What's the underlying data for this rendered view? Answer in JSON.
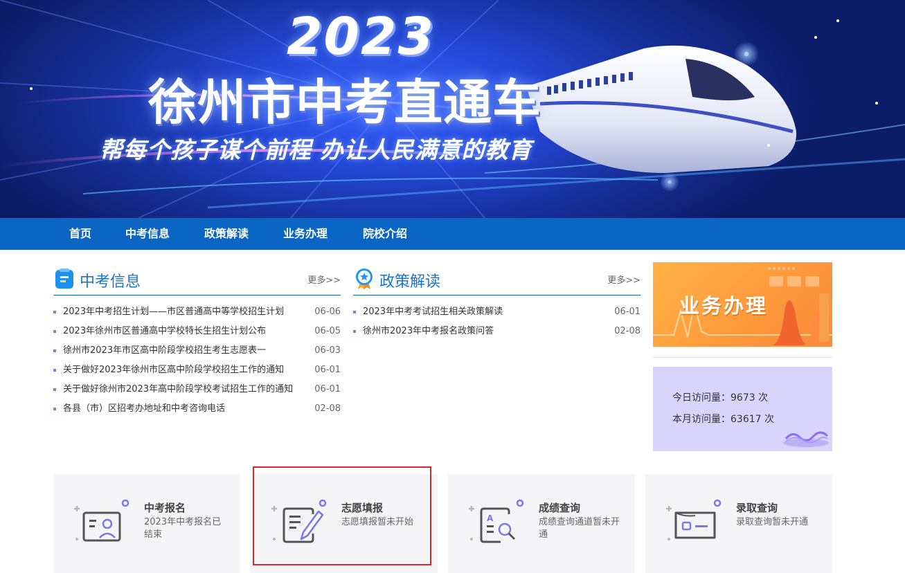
{
  "banner": {
    "year": "2023",
    "title": "徐州市中考直通车",
    "slogan": "帮每个孩子谋个前程  办让人民满意的教育"
  },
  "nav": {
    "items": [
      {
        "label": "首页"
      },
      {
        "label": "中考信息"
      },
      {
        "label": "政策解读"
      },
      {
        "label": "业务办理"
      },
      {
        "label": "院校介绍"
      }
    ]
  },
  "exam_info": {
    "title": "中考信息",
    "more": "更多>>",
    "items": [
      {
        "title": "2023年中考招生计划——市区普通高中等学校招生计划",
        "date": "06-06"
      },
      {
        "title": "2023年徐州市区普通高中学校特长生招生计划公布",
        "date": "06-05"
      },
      {
        "title": "徐州市2023年市区高中阶段学校招生考生志愿表一",
        "date": "06-03"
      },
      {
        "title": "关于做好2023年徐州市区高中阶段学校招生工作的通知",
        "date": "06-01"
      },
      {
        "title": "关于做好徐州市2023年高中阶段学校考试招生工作的通知",
        "date": "06-01"
      },
      {
        "title": "各县（市）区招考办地址和中考咨询电话",
        "date": "02-08"
      }
    ]
  },
  "policy": {
    "title": "政策解读",
    "more": "更多>>",
    "items": [
      {
        "title": "2023年中考考试招生相关政策解读",
        "date": "06-01"
      },
      {
        "title": "徐州市2023年中考报名政策问答",
        "date": "02-08"
      }
    ]
  },
  "business": {
    "label": "业务办理"
  },
  "visits": {
    "today": "今日访问量：9673 次",
    "month": "本月访问量：63617 次"
  },
  "services": [
    {
      "title": "中考报名",
      "desc": "2023年中考报名已结束",
      "icon": "id-card-icon"
    },
    {
      "title": "志愿填报",
      "desc": "志愿填报暂未开始",
      "icon": "form-pen-icon"
    },
    {
      "title": "成绩查询",
      "desc": "成绩查询通道暂未开通",
      "icon": "search-doc-icon"
    },
    {
      "title": "录取查询",
      "desc": "录取查询暂未开通",
      "icon": "ticket-icon"
    }
  ],
  "colors": {
    "nav_bg": "#0b66c3",
    "accent": "#1a73cf",
    "highlight_border": "#d9272e",
    "card_bg": "#f5f5f7",
    "icon_purple": "#7b76e8"
  }
}
